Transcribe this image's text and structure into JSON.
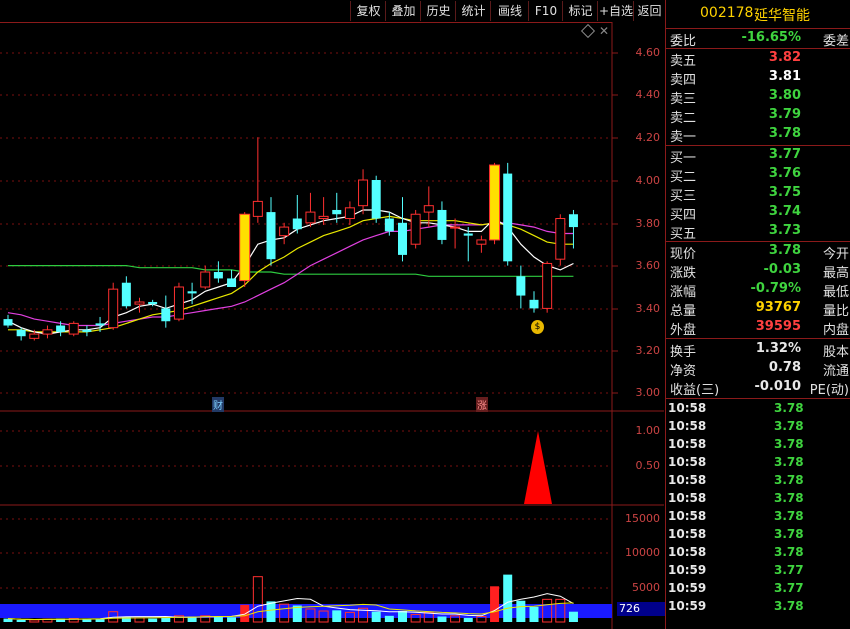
{
  "toolbar": {
    "buttons": [
      "复权",
      "叠加",
      "历史",
      "统计",
      "画线",
      "F10",
      "标记",
      "+自选",
      "返回"
    ]
  },
  "price_axis": [
    "4.60",
    "4.40",
    "4.20",
    "4.00",
    "3.80",
    "3.60",
    "3.40",
    "3.20",
    "3.00"
  ],
  "indicator_axis": [
    "1.00",
    "0.50"
  ],
  "volume_axis": [
    "15000",
    "10000",
    "5000"
  ],
  "volume_current": "726",
  "flags": {
    "cai": "财",
    "zhang": "涨"
  },
  "stock": {
    "code": "002178",
    "name": "延华智能"
  },
  "quote": {
    "weibi": {
      "label": "委比",
      "value": "-16.65%",
      "label2": "委差"
    },
    "sell": [
      {
        "label": "卖五",
        "price": "3.82",
        "color": "#ff4040"
      },
      {
        "label": "卖四",
        "price": "3.81",
        "color": "#ffffff"
      },
      {
        "label": "卖三",
        "price": "3.80",
        "color": "#3fd43f"
      },
      {
        "label": "卖二",
        "price": "3.79",
        "color": "#3fd43f"
      },
      {
        "label": "卖一",
        "price": "3.78",
        "color": "#3fd43f"
      }
    ],
    "buy": [
      {
        "label": "买一",
        "price": "3.77",
        "color": "#3fd43f"
      },
      {
        "label": "买二",
        "price": "3.76",
        "color": "#3fd43f"
      },
      {
        "label": "买三",
        "price": "3.75",
        "color": "#3fd43f"
      },
      {
        "label": "买四",
        "price": "3.74",
        "color": "#3fd43f"
      },
      {
        "label": "买五",
        "price": "3.73",
        "color": "#3fd43f"
      }
    ],
    "stats": [
      {
        "label": "现价",
        "value": "3.78",
        "label2": "今开",
        "color": "#3fd43f"
      },
      {
        "label": "涨跌",
        "value": "-0.03",
        "label2": "最高",
        "color": "#3fd43f"
      },
      {
        "label": "涨幅",
        "value": "-0.79%",
        "label2": "最低",
        "color": "#3fd43f"
      },
      {
        "label": "总量",
        "value": "93767",
        "label2": "量比",
        "color": "#ffd200"
      },
      {
        "label": "外盘",
        "value": "39595",
        "label2": "内盘",
        "color": "#ff4040"
      }
    ],
    "stats2": [
      {
        "label": "换手",
        "value": "1.32%",
        "label2": "股本",
        "color": "#e8e8e8"
      },
      {
        "label": "净资",
        "value": "0.78",
        "label2": "流通",
        "color": "#e8e8e8"
      },
      {
        "label": "收益(三)",
        "value": "-0.010",
        "label2": "PE(动)",
        "color": "#e8e8e8"
      }
    ]
  },
  "ticks": [
    {
      "time": "10:58",
      "price": "3.78"
    },
    {
      "time": "10:58",
      "price": "3.78"
    },
    {
      "time": "10:58",
      "price": "3.78"
    },
    {
      "time": "10:58",
      "price": "3.78"
    },
    {
      "time": "10:58",
      "price": "3.78"
    },
    {
      "time": "10:58",
      "price": "3.78"
    },
    {
      "time": "10:58",
      "price": "3.78"
    },
    {
      "time": "10:58",
      "price": "3.78"
    },
    {
      "time": "10:58",
      "price": "3.78"
    },
    {
      "time": "10:59",
      "price": "3.77"
    },
    {
      "time": "10:59",
      "price": "3.77"
    },
    {
      "time": "10:59",
      "price": "3.78"
    }
  ],
  "chart_data": {
    "type": "candlestick",
    "price_range": [
      3.0,
      4.7
    ],
    "candles": [
      {
        "o": 3.35,
        "h": 3.37,
        "l": 3.31,
        "c": 3.32
      },
      {
        "o": 3.3,
        "h": 3.31,
        "l": 3.25,
        "c": 3.27
      },
      {
        "o": 3.26,
        "h": 3.3,
        "l": 3.25,
        "c": 3.28
      },
      {
        "o": 3.28,
        "h": 3.32,
        "l": 3.26,
        "c": 3.3
      },
      {
        "o": 3.32,
        "h": 3.34,
        "l": 3.27,
        "c": 3.29
      },
      {
        "o": 3.28,
        "h": 3.34,
        "l": 3.27,
        "c": 3.33
      },
      {
        "o": 3.3,
        "h": 3.32,
        "l": 3.27,
        "c": 3.29
      },
      {
        "o": 3.33,
        "h": 3.36,
        "l": 3.29,
        "c": 3.32
      },
      {
        "o": 3.31,
        "h": 3.52,
        "l": 3.3,
        "c": 3.49
      },
      {
        "o": 3.52,
        "h": 3.55,
        "l": 3.4,
        "c": 3.41
      },
      {
        "o": 3.42,
        "h": 3.45,
        "l": 3.38,
        "c": 3.43
      },
      {
        "o": 3.43,
        "h": 3.44,
        "l": 3.41,
        "c": 3.42
      },
      {
        "o": 3.4,
        "h": 3.46,
        "l": 3.31,
        "c": 3.34
      },
      {
        "o": 3.35,
        "h": 3.52,
        "l": 3.34,
        "c": 3.5
      },
      {
        "o": 3.48,
        "h": 3.52,
        "l": 3.42,
        "c": 3.47
      },
      {
        "o": 3.5,
        "h": 3.6,
        "l": 3.49,
        "c": 3.57
      },
      {
        "o": 3.57,
        "h": 3.62,
        "l": 3.52,
        "c": 3.54
      },
      {
        "o": 3.54,
        "h": 3.58,
        "l": 3.5,
        "c": 3.5
      },
      {
        "o": 3.53,
        "h": 3.85,
        "l": 3.5,
        "c": 3.84
      },
      {
        "o": 3.83,
        "h": 4.2,
        "l": 3.8,
        "c": 3.9
      },
      {
        "o": 3.85,
        "h": 3.92,
        "l": 3.6,
        "c": 3.63
      },
      {
        "o": 3.74,
        "h": 3.8,
        "l": 3.7,
        "c": 3.78
      },
      {
        "o": 3.82,
        "h": 3.93,
        "l": 3.75,
        "c": 3.77
      },
      {
        "o": 3.8,
        "h": 3.94,
        "l": 3.78,
        "c": 3.85
      },
      {
        "o": 3.82,
        "h": 3.92,
        "l": 3.79,
        "c": 3.83
      },
      {
        "o": 3.86,
        "h": 3.94,
        "l": 3.8,
        "c": 3.84
      },
      {
        "o": 3.82,
        "h": 3.9,
        "l": 3.79,
        "c": 3.87
      },
      {
        "o": 3.88,
        "h": 4.05,
        "l": 3.84,
        "c": 4.0
      },
      {
        "o": 4.0,
        "h": 4.02,
        "l": 3.8,
        "c": 3.82
      },
      {
        "o": 3.82,
        "h": 3.85,
        "l": 3.74,
        "c": 3.76
      },
      {
        "o": 3.8,
        "h": 3.92,
        "l": 3.62,
        "c": 3.65
      },
      {
        "o": 3.7,
        "h": 3.86,
        "l": 3.68,
        "c": 3.84
      },
      {
        "o": 3.85,
        "h": 3.97,
        "l": 3.78,
        "c": 3.88
      },
      {
        "o": 3.86,
        "h": 3.9,
        "l": 3.7,
        "c": 3.72
      },
      {
        "o": 3.78,
        "h": 3.82,
        "l": 3.68,
        "c": 3.78
      },
      {
        "o": 3.75,
        "h": 3.78,
        "l": 3.62,
        "c": 3.74
      },
      {
        "o": 3.7,
        "h": 3.74,
        "l": 3.66,
        "c": 3.72
      },
      {
        "o": 3.72,
        "h": 4.08,
        "l": 3.7,
        "c": 4.07
      },
      {
        "o": 4.03,
        "h": 4.08,
        "l": 3.6,
        "c": 3.62
      },
      {
        "o": 3.55,
        "h": 3.6,
        "l": 3.4,
        "c": 3.46
      },
      {
        "o": 3.44,
        "h": 3.48,
        "l": 3.38,
        "c": 3.4
      },
      {
        "o": 3.4,
        "h": 3.62,
        "l": 3.38,
        "c": 3.61
      },
      {
        "o": 3.63,
        "h": 3.84,
        "l": 3.6,
        "c": 3.82
      },
      {
        "o": 3.84,
        "h": 3.86,
        "l": 3.68,
        "c": 3.78
      }
    ],
    "ma_white": [
      3.34,
      3.31,
      3.29,
      3.28,
      3.29,
      3.3,
      3.3,
      3.31,
      3.36,
      3.38,
      3.41,
      3.42,
      3.4,
      3.42,
      3.44,
      3.48,
      3.5,
      3.52,
      3.6,
      3.7,
      3.72,
      3.73,
      3.77,
      3.79,
      3.81,
      3.82,
      3.83,
      3.86,
      3.86,
      3.85,
      3.82,
      3.8,
      3.8,
      3.79,
      3.78,
      3.76,
      3.76,
      3.82,
      3.78,
      3.7,
      3.64,
      3.6,
      3.58,
      3.61
    ],
    "ma_yellow": [
      3.3,
      3.3,
      3.29,
      3.29,
      3.29,
      3.29,
      3.29,
      3.3,
      3.31,
      3.33,
      3.35,
      3.37,
      3.38,
      3.39,
      3.41,
      3.43,
      3.45,
      3.47,
      3.51,
      3.57,
      3.61,
      3.64,
      3.68,
      3.71,
      3.74,
      3.76,
      3.78,
      3.81,
      3.82,
      3.83,
      3.82,
      3.81,
      3.81,
      3.81,
      3.81,
      3.8,
      3.79,
      3.8,
      3.79,
      3.77,
      3.74,
      3.71,
      3.7,
      3.7
    ],
    "ma_magenta": [
      3.38,
      3.37,
      3.35,
      3.34,
      3.33,
      3.32,
      3.32,
      3.32,
      3.33,
      3.34,
      3.35,
      3.36,
      3.36,
      3.37,
      3.38,
      3.39,
      3.4,
      3.41,
      3.43,
      3.46,
      3.49,
      3.52,
      3.56,
      3.6,
      3.63,
      3.66,
      3.69,
      3.72,
      3.74,
      3.76,
      3.76,
      3.77,
      3.78,
      3.79,
      3.79,
      3.79,
      3.79,
      3.8,
      3.8,
      3.79,
      3.78,
      3.76,
      3.75,
      3.75
    ],
    "ma_green": [
      3.6,
      3.6,
      3.6,
      3.6,
      3.6,
      3.6,
      3.6,
      3.6,
      3.6,
      3.6,
      3.59,
      3.59,
      3.59,
      3.59,
      3.59,
      3.58,
      3.58,
      3.58,
      3.57,
      3.57,
      3.57,
      3.56,
      3.56,
      3.56,
      3.56,
      3.56,
      3.56,
      3.56,
      3.56,
      3.56,
      3.56,
      3.56,
      3.55,
      3.55,
      3.55,
      3.55,
      3.55,
      3.55,
      3.55,
      3.55,
      3.55,
      3.55,
      3.55,
      3.55
    ],
    "volumes": [
      500,
      300,
      300,
      400,
      500,
      500,
      500,
      500,
      1500,
      800,
      600,
      500,
      600,
      900,
      800,
      900,
      800,
      700,
      2500,
      6600,
      3000,
      2600,
      2400,
      1900,
      1600,
      1700,
      1400,
      2000,
      1500,
      900,
      1600,
      1100,
      1400,
      800,
      900,
      600,
      800,
      5200,
      6900,
      3100,
      2200,
      3300,
      3300,
      1500
    ]
  }
}
